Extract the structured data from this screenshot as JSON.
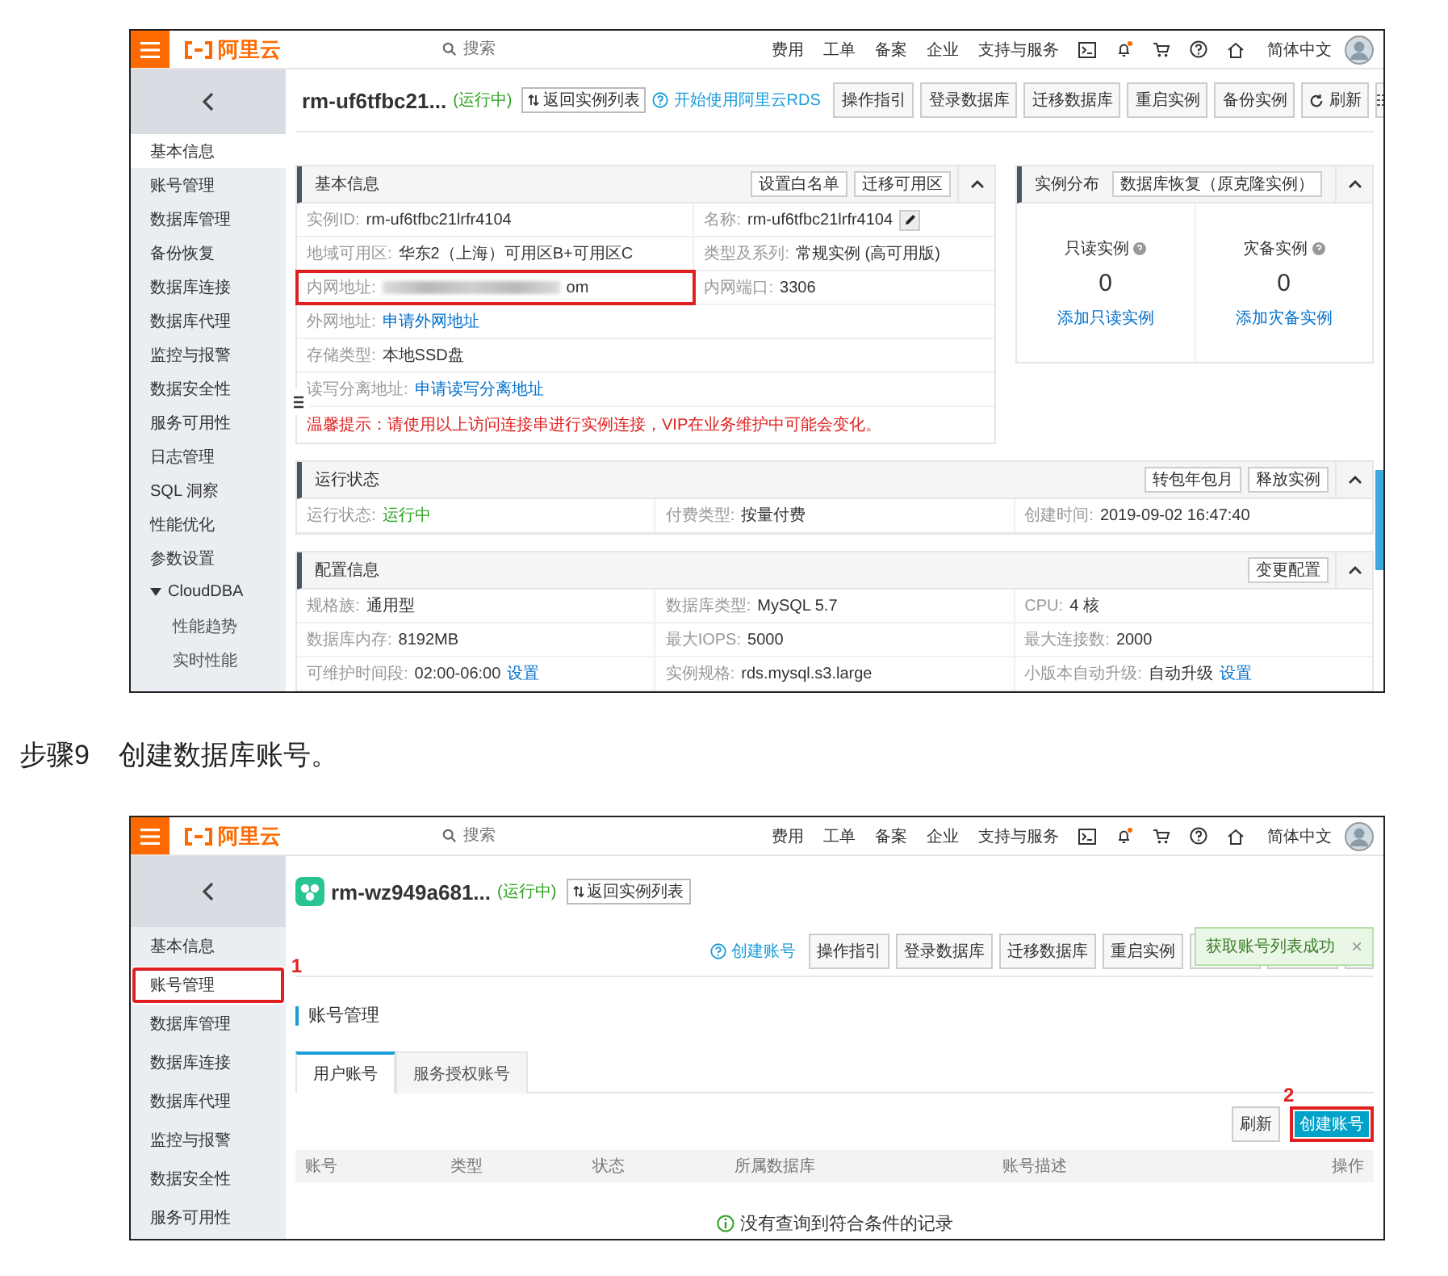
{
  "screenshot_1": {
    "kind": "instance_overview",
    "topbar": {
      "logo": "阿里云",
      "search_placeholder": "搜索",
      "nav": [
        "费用",
        "工单",
        "备案",
        "企业",
        "支持与服务"
      ],
      "language": "简体中文"
    },
    "sidebar": {
      "items": [
        {
          "label": "基本信息",
          "selected": true
        },
        {
          "label": "账号管理",
          "selected": false
        },
        {
          "label": "数据库管理",
          "selected": false
        },
        {
          "label": "备份恢复",
          "selected": false
        },
        {
          "label": "数据库连接",
          "selected": false
        },
        {
          "label": "数据库代理",
          "selected": false
        },
        {
          "label": "监控与报警",
          "selected": false
        },
        {
          "label": "数据安全性",
          "selected": false
        },
        {
          "label": "服务可用性",
          "selected": false
        },
        {
          "label": "日志管理",
          "selected": false
        },
        {
          "label": "SQL 洞察",
          "selected": false
        },
        {
          "label": "性能优化",
          "selected": false
        },
        {
          "label": "参数设置",
          "selected": false
        },
        {
          "label": "CloudDBA",
          "selected": false,
          "expanded": true,
          "children": [
            {
              "label": "性能趋势",
              "selected": false
            },
            {
              "label": "实时性能",
              "selected": false
            }
          ]
        }
      ]
    },
    "header": {
      "instance": "rm-uf6tfbc21...",
      "status": "(运行中)",
      "back_button": "返回实例列表",
      "link": "开始使用阿里云RDS",
      "buttons": [
        {
          "kind": "text",
          "label": "操作指引"
        },
        {
          "kind": "text",
          "label": "登录数据库"
        },
        {
          "kind": "text",
          "label": "迁移数据库"
        },
        {
          "kind": "text",
          "label": "重启实例"
        },
        {
          "kind": "text",
          "label": "备份实例"
        },
        {
          "kind": "refresh",
          "label": "刷新"
        },
        {
          "kind": "list"
        }
      ]
    },
    "basic_info": {
      "title": "基本信息",
      "expanded": true,
      "buttons": [
        "设置白名单",
        "迁移可用区"
      ],
      "rows": [
        [
          {
            "label": "实例ID:",
            "value": "rm-uf6tfbc21lrfr4104",
            "kind": "text"
          },
          {
            "label": "名称:",
            "value": "rm-uf6tfbc21lrfr4104",
            "kind": "text",
            "editable": true
          }
        ],
        [
          {
            "label": "地域可用区:",
            "value": "华东2（上海）可用区B+可用区C",
            "kind": "text"
          },
          {
            "label": "类型及系列:",
            "value": "常规实例 (高可用版)",
            "kind": "text"
          }
        ],
        [
          {
            "label": "内网地址:",
            "value": "om",
            "kind": "blurred",
            "highlighted": true
          },
          {
            "label": "内网端口:",
            "value": "3306",
            "kind": "text"
          }
        ],
        [
          {
            "label": "外网地址:",
            "value": "申请外网地址",
            "kind": "link"
          }
        ],
        [
          {
            "label": "存储类型:",
            "value": "本地SSD盘",
            "kind": "text"
          }
        ],
        [
          {
            "label": "读写分离地址:",
            "value": "申请读写分离地址",
            "kind": "link"
          }
        ]
      ],
      "notice": "温馨提示：请使用以上访问连接串进行实例连接，VIP在业务维护中可能会变化。"
    },
    "distribution": {
      "title": "实例分布",
      "expanded": true,
      "button": "数据库恢复（原克隆实例）",
      "stats": [
        {
          "label": "只读实例",
          "count": "0",
          "link": "添加只读实例"
        },
        {
          "label": "灾备实例",
          "count": "0",
          "link": "添加灾备实例"
        }
      ]
    },
    "run_status": {
      "title": "运行状态",
      "expanded": true,
      "buttons": [
        "转包年包月",
        "释放实例"
      ],
      "rows": [
        [
          {
            "label": "运行状态:",
            "value": "运行中",
            "kind": "status"
          },
          {
            "label": "付费类型:",
            "value": "按量付费",
            "kind": "text"
          },
          {
            "label": "创建时间:",
            "value": "2019-09-02 16:47:40",
            "kind": "text"
          }
        ]
      ]
    },
    "config": {
      "title": "配置信息",
      "expanded": true,
      "buttons": [
        "变更配置"
      ],
      "rows": [
        [
          {
            "label": "规格族:",
            "value": "通用型",
            "kind": "text"
          },
          {
            "label": "数据库类型:",
            "value": "MySQL 5.7",
            "kind": "text"
          },
          {
            "label": "CPU:",
            "value": "4 核",
            "kind": "text"
          }
        ],
        [
          {
            "label": "数据库内存:",
            "value": "8192MB",
            "kind": "text"
          },
          {
            "label": "最大IOPS:",
            "value": "5000",
            "kind": "text"
          },
          {
            "label": "最大连接数:",
            "value": "2000",
            "kind": "text"
          }
        ],
        [
          {
            "label": "可维护时间段:",
            "value": "02:00-06:00",
            "kind": "text",
            "link": "设置"
          },
          {
            "label": "实例规格:",
            "value": "rds.mysql.s3.large",
            "kind": "text"
          },
          {
            "label": "小版本自动升级:",
            "value": "自动升级",
            "kind": "text",
            "link": "设置"
          }
        ]
      ]
    }
  },
  "step": {
    "label": "步骤9",
    "text": "创建数据库账号。"
  },
  "screenshot_2": {
    "kind": "account_management",
    "topbar": {
      "logo": "阿里云",
      "search_placeholder": "搜索",
      "nav": [
        "费用",
        "工单",
        "备案",
        "企业",
        "支持与服务"
      ],
      "language": "简体中文"
    },
    "sidebar": {
      "items": [
        {
          "label": "基本信息",
          "selected": false
        },
        {
          "label": "账号管理",
          "selected": true,
          "highlighted": true,
          "annotation": "1"
        },
        {
          "label": "数据库管理",
          "selected": false
        },
        {
          "label": "数据库连接",
          "selected": false
        },
        {
          "label": "数据库代理",
          "selected": false
        },
        {
          "label": "监控与报警",
          "selected": false
        },
        {
          "label": "数据安全性",
          "selected": false
        },
        {
          "label": "服务可用性",
          "selected": false
        }
      ]
    },
    "header": {
      "instance": "rm-wz949a681...",
      "status": "(运行中)",
      "back_button": "返回实例列表",
      "link": "创建账号",
      "buttons": [
        {
          "kind": "text",
          "label": "操作指引"
        },
        {
          "kind": "text",
          "label": "登录数据库"
        },
        {
          "kind": "text",
          "label": "迁移数据库"
        },
        {
          "kind": "text",
          "label": "重启实例"
        },
        {
          "kind": "covered"
        },
        {
          "kind": "covered"
        },
        {
          "kind": "covered"
        }
      ]
    },
    "toast": {
      "text": "获取账号列表成功",
      "close": "×"
    },
    "section_title": "账号管理",
    "tabs": [
      {
        "label": "用户账号",
        "selected": true
      },
      {
        "label": "服务授权账号",
        "selected": false
      }
    ],
    "actions": [
      {
        "label": "刷新",
        "kind": "default"
      },
      {
        "label": "创建账号",
        "kind": "primary",
        "highlighted": true,
        "annotation": "2"
      }
    ],
    "table": {
      "columns": [
        "账号",
        "类型",
        "状态",
        "所属数据库",
        "账号描述",
        "操作"
      ],
      "empty_text": "没有查询到符合条件的记录"
    }
  }
}
